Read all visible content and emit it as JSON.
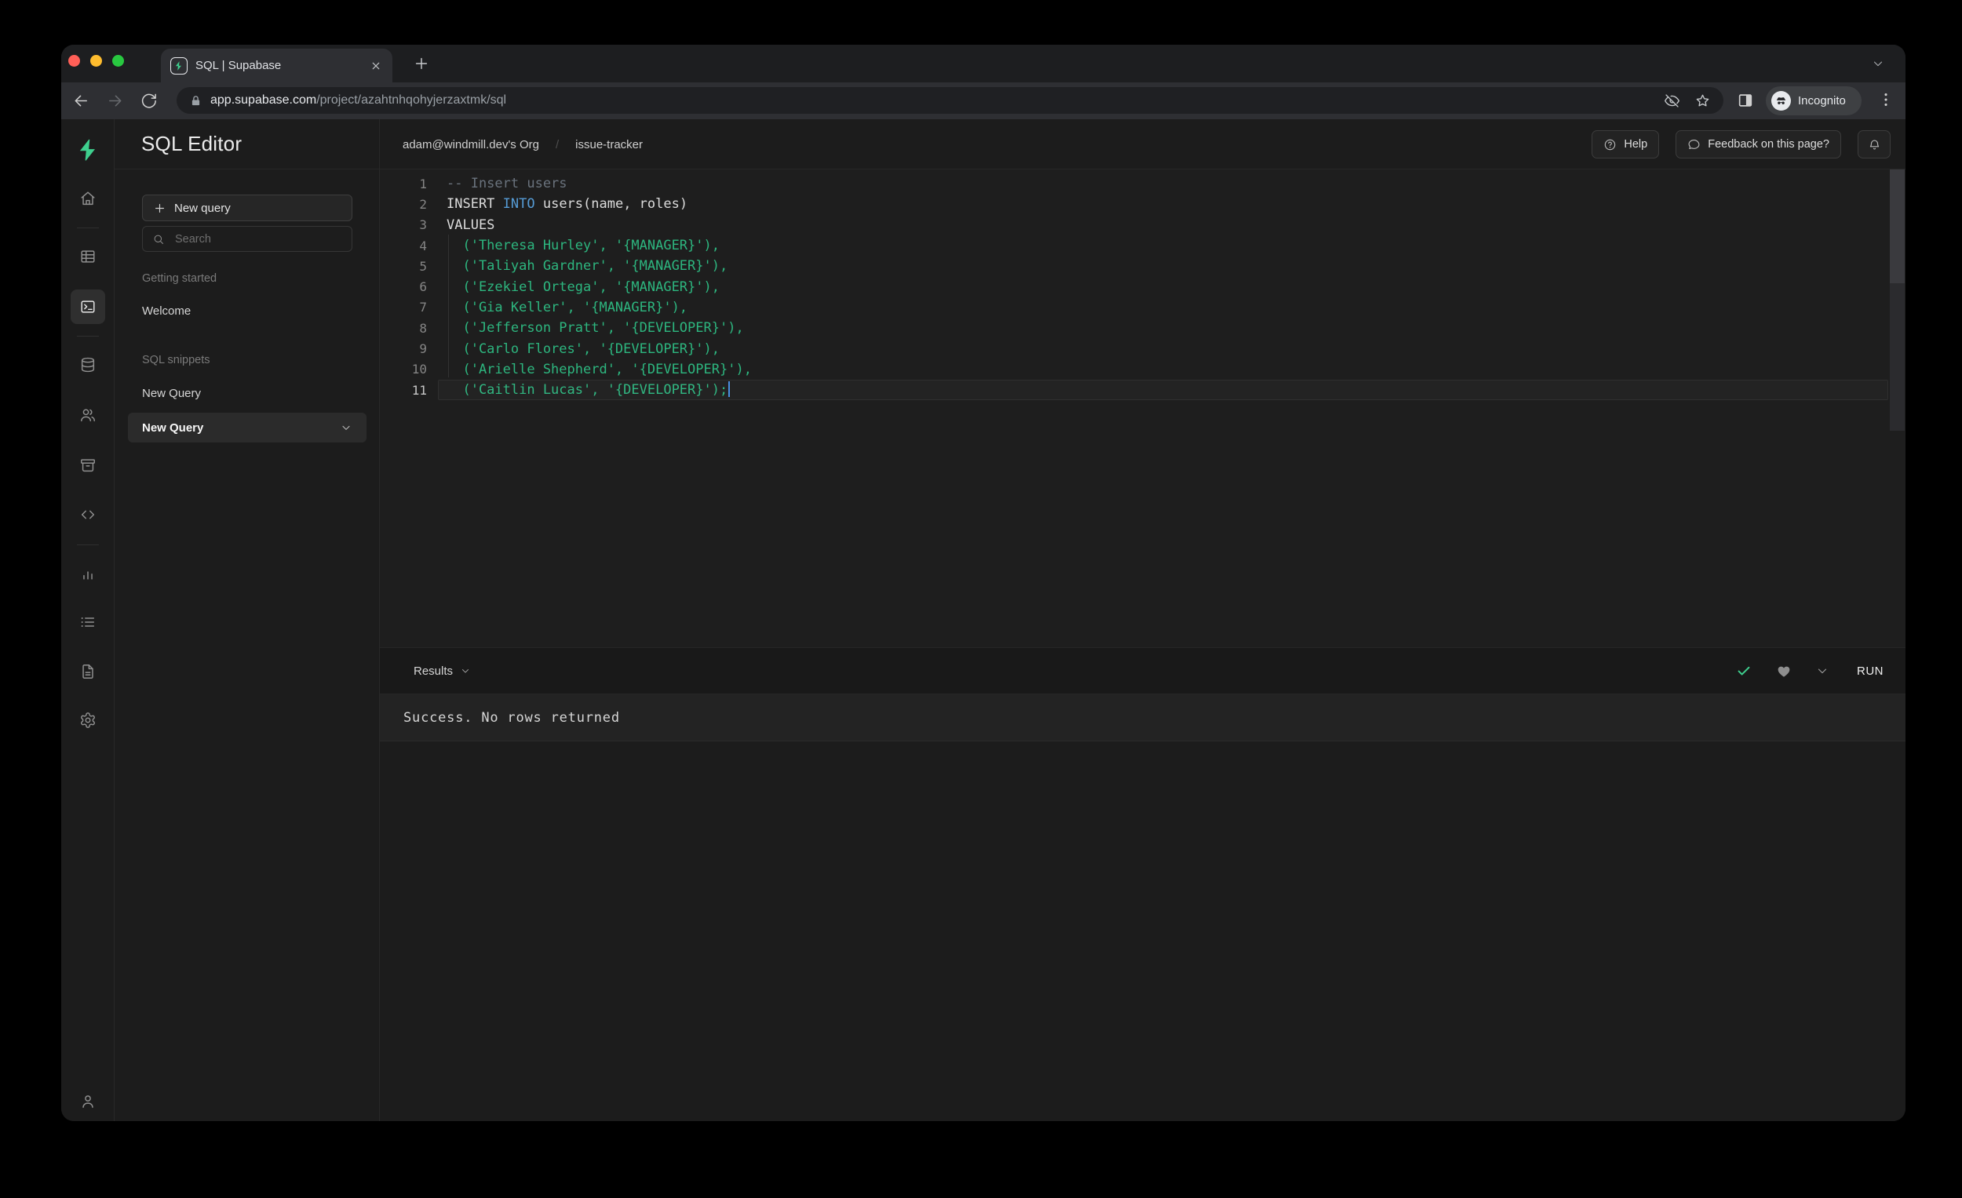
{
  "browser": {
    "tab_title": "SQL | Supabase",
    "url_domain": "app.supabase.com",
    "url_path": "/project/azahtnhqohyjerzaxtmk/sql",
    "incognito_label": "Incognito"
  },
  "rail": {
    "logo_icon": "supabase-logo",
    "items": [
      {
        "icon": "home-icon"
      },
      {
        "divider": true
      },
      {
        "icon": "table-editor-icon"
      },
      {
        "icon": "sql-editor-icon",
        "selected": true
      },
      {
        "divider": true
      },
      {
        "icon": "database-icon"
      },
      {
        "icon": "auth-users-icon"
      },
      {
        "icon": "storage-icon"
      },
      {
        "icon": "edge-functions-icon"
      },
      {
        "divider": true
      },
      {
        "icon": "reports-icon"
      },
      {
        "icon": "logs-icon"
      },
      {
        "icon": "docs-icon"
      },
      {
        "icon": "settings-gear-icon"
      }
    ],
    "account_icon": "account-icon"
  },
  "panel": {
    "title": "SQL Editor",
    "new_query_button": "New query",
    "search_placeholder": "Search",
    "sections": [
      {
        "label": "Getting started",
        "items": [
          {
            "label": "Welcome"
          }
        ]
      },
      {
        "label": "SQL snippets",
        "items": [
          {
            "label": "New Query"
          },
          {
            "label": "New Query",
            "selected": true
          }
        ]
      }
    ]
  },
  "header": {
    "breadcrumb": {
      "org": "adam@windmill.dev's Org",
      "separator": "/",
      "project": "issue-tracker"
    },
    "help_button": "Help",
    "feedback_button": "Feedback on this page?"
  },
  "editor": {
    "lines": [
      {
        "n": "1",
        "segs": [
          [
            "comment",
            "-- Insert users"
          ]
        ]
      },
      {
        "n": "2",
        "segs": [
          [
            "plain",
            "INSERT "
          ],
          [
            "keyword",
            "INTO"
          ],
          [
            "plain",
            " users(name, roles)"
          ]
        ]
      },
      {
        "n": "3",
        "segs": [
          [
            "plain",
            "VALUES"
          ]
        ]
      },
      {
        "n": "4",
        "segs": [
          [
            "string",
            "  ('Theresa Hurley', '{MANAGER}'),"
          ]
        ]
      },
      {
        "n": "5",
        "segs": [
          [
            "string",
            "  ('Taliyah Gardner', '{MANAGER}'),"
          ]
        ]
      },
      {
        "n": "6",
        "segs": [
          [
            "string",
            "  ('Ezekiel Ortega', '{MANAGER}'),"
          ]
        ]
      },
      {
        "n": "7",
        "segs": [
          [
            "string",
            "  ('Gia Keller', '{MANAGER}'),"
          ]
        ]
      },
      {
        "n": "8",
        "segs": [
          [
            "string",
            "  ('Jefferson Pratt', '{DEVELOPER}'),"
          ]
        ]
      },
      {
        "n": "9",
        "segs": [
          [
            "string",
            "  ('Carlo Flores', '{DEVELOPER}'),"
          ]
        ]
      },
      {
        "n": "10",
        "segs": [
          [
            "string",
            "  ('Arielle Shepherd', '{DEVELOPER}'),"
          ]
        ]
      },
      {
        "n": "11",
        "segs": [
          [
            "string",
            "  ('Caitlin Lucas', '{DEVELOPER}');"
          ]
        ],
        "current": true,
        "cursor": true
      }
    ]
  },
  "results": {
    "tab_label": "Results",
    "message": "Success. No rows returned",
    "run_button": "RUN"
  },
  "colors": {
    "accent_green": "#3ECF8E",
    "token_comment": "#6A737D",
    "token_plain": "#DCDCDC",
    "token_keyword": "#569CD6",
    "token_string": "#2DB67F",
    "cursor_blue": "#4A90E2",
    "traffic_red": "#FF5F57",
    "traffic_yellow": "#FEBC2E",
    "traffic_green": "#28C840"
  }
}
